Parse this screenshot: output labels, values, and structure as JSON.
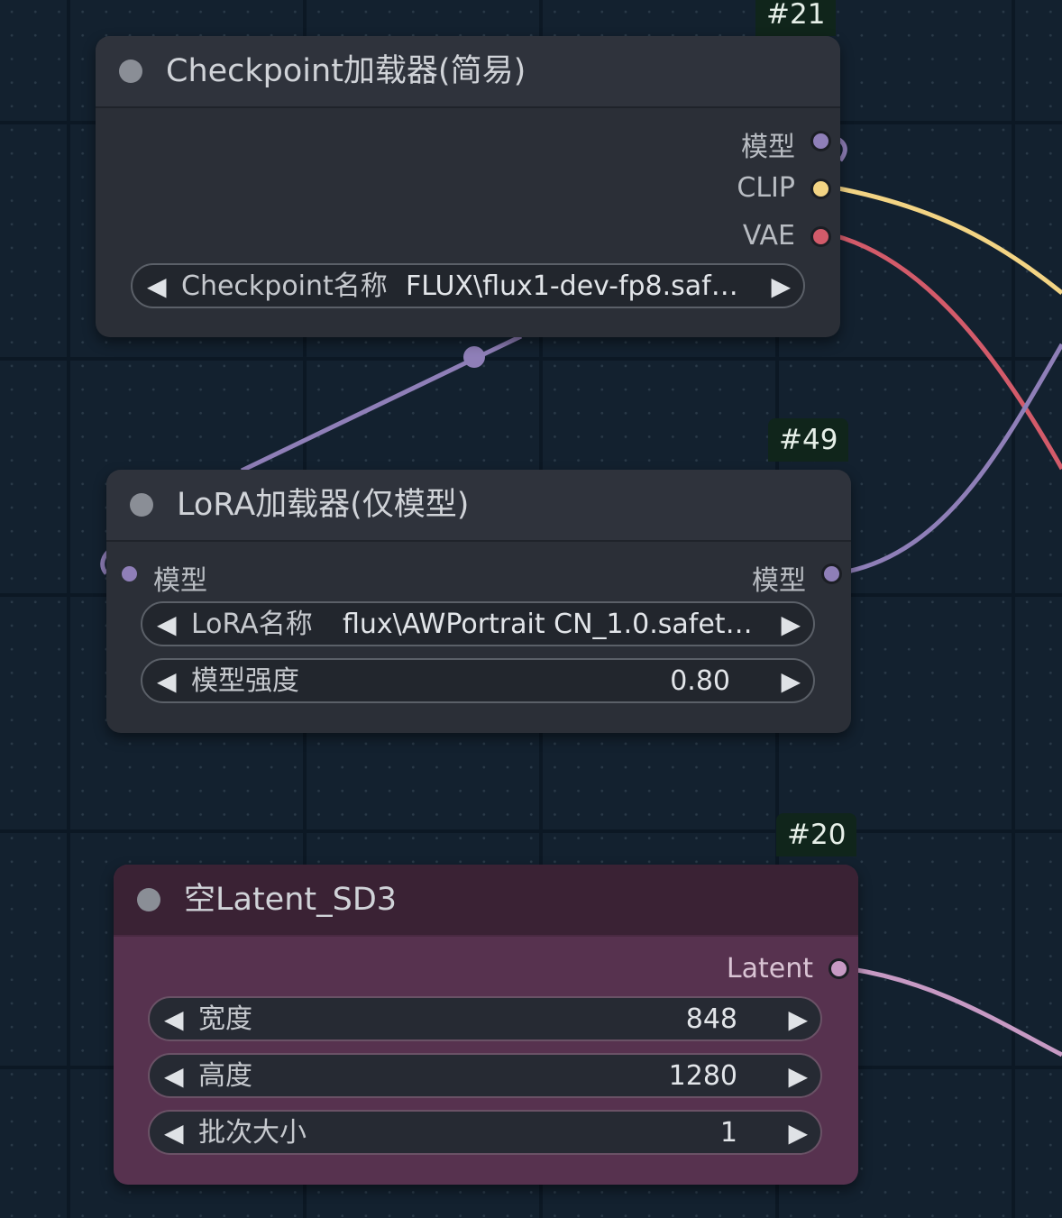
{
  "nodes": {
    "checkpoint": {
      "badge": "#21",
      "title": "Checkpoint加载器(简易)",
      "outputs": [
        "模型",
        "CLIP",
        "VAE"
      ],
      "widget": {
        "label": "Checkpoint名称",
        "value": "FLUX\\flux1-dev-fp8.saf…"
      }
    },
    "lora": {
      "badge": "#49",
      "title": "LoRA加载器(仅模型)",
      "input": "模型",
      "output": "模型",
      "widgets": [
        {
          "label": "LoRA名称",
          "value": "flux\\AWPortrait CN_1.0.safet…"
        },
        {
          "label": "模型强度",
          "value": "0.80"
        }
      ]
    },
    "latent": {
      "badge": "#20",
      "title": "空Latent_SD3",
      "output": "Latent",
      "widgets": [
        {
          "label": "宽度",
          "value": "848"
        },
        {
          "label": "高度",
          "value": "1280"
        },
        {
          "label": "批次大小",
          "value": "1"
        }
      ]
    }
  },
  "colors": {
    "model": "#8f7fb8",
    "clip": "#f3d484",
    "vae": "#d35b6a",
    "latent": "#c79ac4",
    "canvas": "#13212f"
  },
  "icons": {
    "node_dot": "circle",
    "prev": "triangle-left",
    "next": "triangle-right"
  }
}
